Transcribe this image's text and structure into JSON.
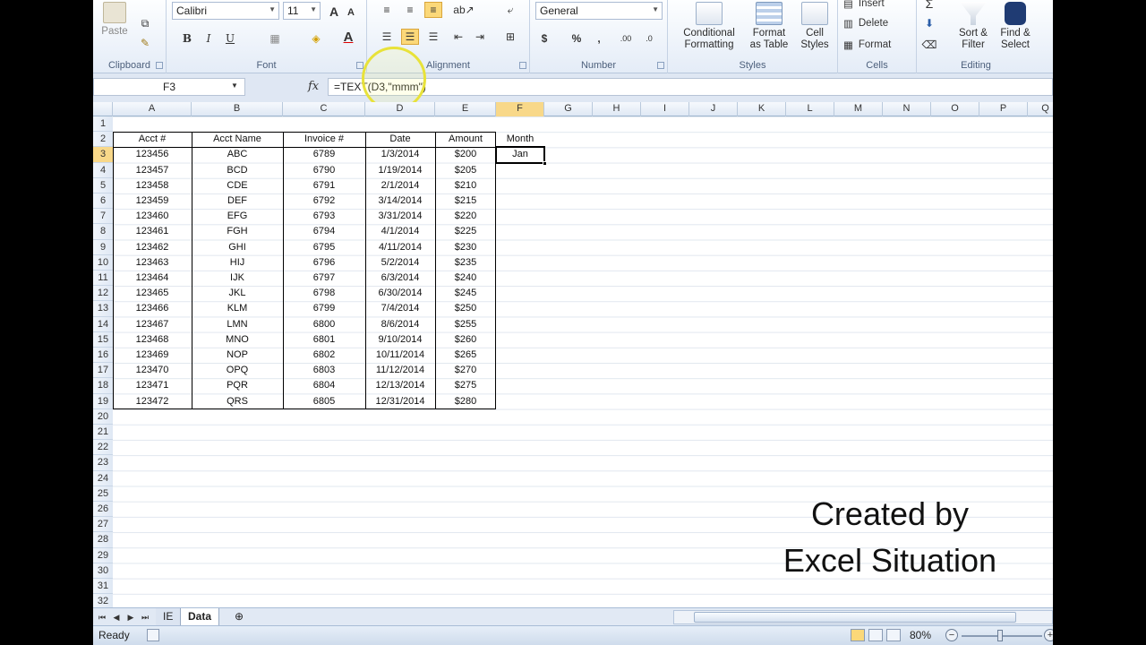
{
  "ribbon": {
    "clipboard": {
      "label": "Clipboard",
      "paste": "Paste"
    },
    "font": {
      "label": "Font",
      "name": "Calibri",
      "size": "11",
      "bold": "B",
      "italic": "I",
      "underline": "U"
    },
    "alignment": {
      "label": "Alignment"
    },
    "number": {
      "label": "Number",
      "format": "General",
      "currency": "$",
      "percent": "%",
      "comma": ",",
      "inc_dec": ".00",
      "dec_dec": ".0"
    },
    "styles": {
      "label": "Styles",
      "conditional": [
        "Conditional",
        "Formatting"
      ],
      "format_table": [
        "Format",
        "as Table"
      ],
      "cell_styles": [
        "Cell",
        "Styles"
      ]
    },
    "cells": {
      "label": "Cells",
      "insert": "Insert",
      "delete": "Delete",
      "format": "Format"
    },
    "editing": {
      "label": "Editing",
      "sum": "Σ",
      "sort": [
        "Sort &",
        "Filter"
      ],
      "find": [
        "Find &",
        "Select"
      ]
    }
  },
  "formula_bar": {
    "name_box": "F3",
    "fx": "fx",
    "formula": "=TEXT(D3,\"mmm\")"
  },
  "columns": [
    "A",
    "B",
    "C",
    "D",
    "E",
    "F",
    "G",
    "H",
    "I",
    "J",
    "K",
    "L",
    "M",
    "N",
    "O",
    "P",
    "Q"
  ],
  "row_numbers": [
    1,
    2,
    3,
    4,
    5,
    6,
    7,
    8,
    9,
    10,
    11,
    12,
    13,
    14,
    15,
    16,
    17,
    18,
    19,
    20,
    21,
    22,
    23,
    24,
    25,
    26,
    27,
    28,
    29,
    30,
    31,
    32
  ],
  "table": {
    "headers": [
      "Acct #",
      "Acct Name",
      "Invoice #",
      "Date",
      "Amount"
    ],
    "rows": [
      [
        "123456",
        "ABC",
        "6789",
        "1/3/2014",
        "$200"
      ],
      [
        "123457",
        "BCD",
        "6790",
        "1/19/2014",
        "$205"
      ],
      [
        "123458",
        "CDE",
        "6791",
        "2/1/2014",
        "$210"
      ],
      [
        "123459",
        "DEF",
        "6792",
        "3/14/2014",
        "$215"
      ],
      [
        "123460",
        "EFG",
        "6793",
        "3/31/2014",
        "$220"
      ],
      [
        "123461",
        "FGH",
        "6794",
        "4/1/2014",
        "$225"
      ],
      [
        "123462",
        "GHI",
        "6795",
        "4/11/2014",
        "$230"
      ],
      [
        "123463",
        "HIJ",
        "6796",
        "5/2/2014",
        "$235"
      ],
      [
        "123464",
        "IJK",
        "6797",
        "6/3/2014",
        "$240"
      ],
      [
        "123465",
        "JKL",
        "6798",
        "6/30/2014",
        "$245"
      ],
      [
        "123466",
        "KLM",
        "6799",
        "7/4/2014",
        "$250"
      ],
      [
        "123467",
        "LMN",
        "6800",
        "8/6/2014",
        "$255"
      ],
      [
        "123468",
        "MNO",
        "6801",
        "9/10/2014",
        "$260"
      ],
      [
        "123469",
        "NOP",
        "6802",
        "10/11/2014",
        "$265"
      ],
      [
        "123470",
        "OPQ",
        "6803",
        "11/12/2014",
        "$270"
      ],
      [
        "123471",
        "PQR",
        "6804",
        "12/13/2014",
        "$275"
      ],
      [
        "123472",
        "QRS",
        "6805",
        "12/31/2014",
        "$280"
      ]
    ]
  },
  "month_header": "Month",
  "month_value": "Jan",
  "watermark": [
    "Created by",
    "Excel Situation"
  ],
  "sheet_tabs": [
    "IE",
    "Data"
  ],
  "status": {
    "text": "Ready",
    "zoom": "80%",
    "minus": "−",
    "plus": "+"
  }
}
